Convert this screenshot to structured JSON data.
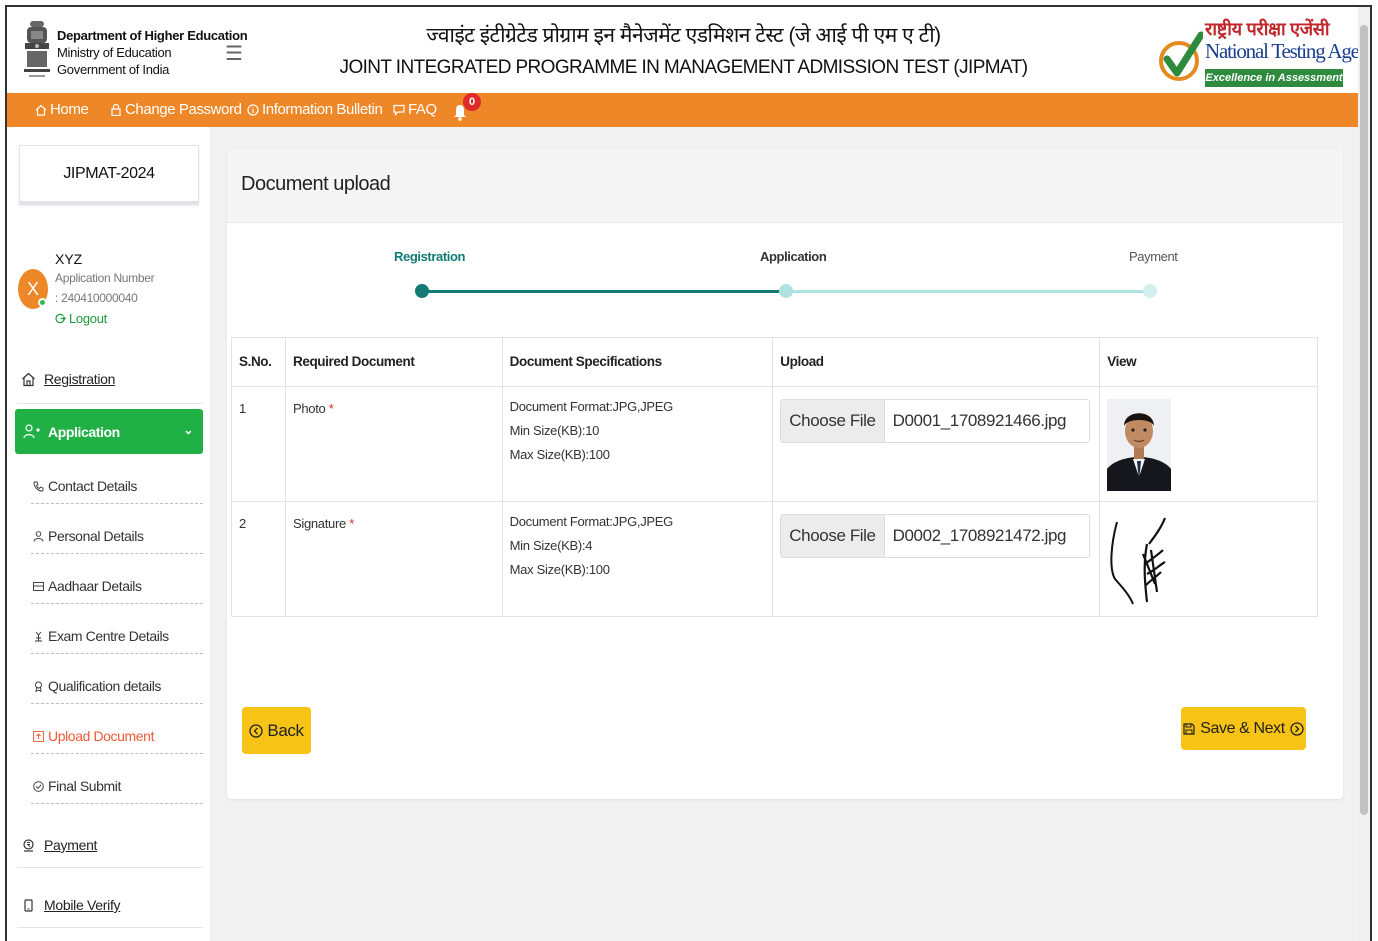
{
  "header": {
    "dept_line1": "Department of Higher Education",
    "dept_line2": "Ministry of Education",
    "dept_line3": "Government of India",
    "title_hindi": "ज्वाइंट इंटीग्रेटेड प्रोग्राम इन मैनेजमेंट एडमिशन टेस्ट (जे आई पी एम ए टी)",
    "title_english": "JOINT INTEGRATED PROGRAMME IN MANAGEMENT ADMISSION TEST (JIPMAT)",
    "nta_hindi": "राष्ट्रीय परीक्षा एजेंसी",
    "nta_english": "National Testing Agency",
    "nta_tagline": "Excellence in Assessment"
  },
  "nav": {
    "home": "Home",
    "change_password": "Change Password",
    "information_bulletin": "Information Bulletin",
    "faq": "FAQ",
    "notification_count": "0"
  },
  "sidebar": {
    "exam": "JIPMAT-2024",
    "avatar_initial": "X",
    "user_name": "XYZ",
    "app_number_label": "Application Number",
    "app_number": ": 240410000040",
    "logout": "Logout",
    "registration": "Registration",
    "application": "Application",
    "sub_items": [
      {
        "label": "Contact Details"
      },
      {
        "label": "Personal Details"
      },
      {
        "label": "Aadhaar Details"
      },
      {
        "label": "Exam Centre Details"
      },
      {
        "label": "Qualification details"
      },
      {
        "label": "Upload Document"
      },
      {
        "label": "Final Submit"
      }
    ],
    "payment": "Payment",
    "mobile_verify": "Mobile Verify"
  },
  "main": {
    "title": "Document upload",
    "steps": [
      {
        "label": "Registration"
      },
      {
        "label": "Application"
      },
      {
        "label": "Payment"
      }
    ],
    "table": {
      "headers": [
        "S.No.",
        "Required Document",
        "Document Specifications",
        "Upload",
        "View"
      ],
      "rows": [
        {
          "sno": "1",
          "document": "Photo",
          "required_mark": "*",
          "spec_format": "Document Format:JPG,JPEG",
          "spec_min": "Min Size(KB):10",
          "spec_max": "Max Size(KB):100",
          "choose_label": "Choose File",
          "file_name": "D0001_1708921466.jpg"
        },
        {
          "sno": "2",
          "document": "Signature",
          "required_mark": "*",
          "spec_format": "Document Format:JPG,JPEG",
          "spec_min": "Min Size(KB):4",
          "spec_max": "Max Size(KB):100",
          "choose_label": "Choose File",
          "file_name": "D0002_1708921472.jpg"
        }
      ]
    },
    "back_button": "Back",
    "save_next_button": "Save & Next"
  },
  "colors": {
    "nav_orange": "#ee8728",
    "active_green": "#20b046",
    "step_teal": "#137a75",
    "button_yellow": "#f8c317"
  }
}
